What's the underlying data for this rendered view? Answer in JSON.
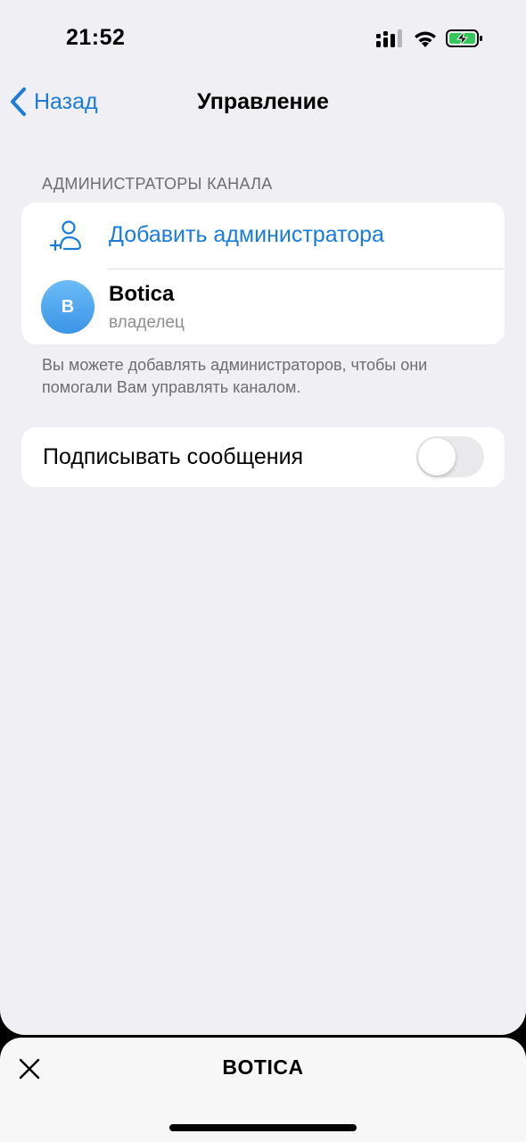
{
  "status_bar": {
    "time": "21:52",
    "icons": [
      "signal-icon",
      "wifi-icon",
      "battery-charging-icon"
    ]
  },
  "nav": {
    "back_label": "Назад",
    "title": "Управление",
    "accent_color": "#1a7bd8"
  },
  "admins_section": {
    "header": "АДМИНИСТРАТОРЫ КАНАЛА",
    "add_admin_label": "Добавить администратора",
    "owner": {
      "avatar_letter": "B",
      "name": "Botica",
      "role": "владелец"
    },
    "footer": "Вы можете добавлять администраторов, чтобы они помогали Вам управлять каналом."
  },
  "sign_messages": {
    "label": "Подписывать сообщения",
    "enabled": false
  },
  "bottom_sheet": {
    "title": "BOTICA",
    "close_icon": "close-icon"
  }
}
